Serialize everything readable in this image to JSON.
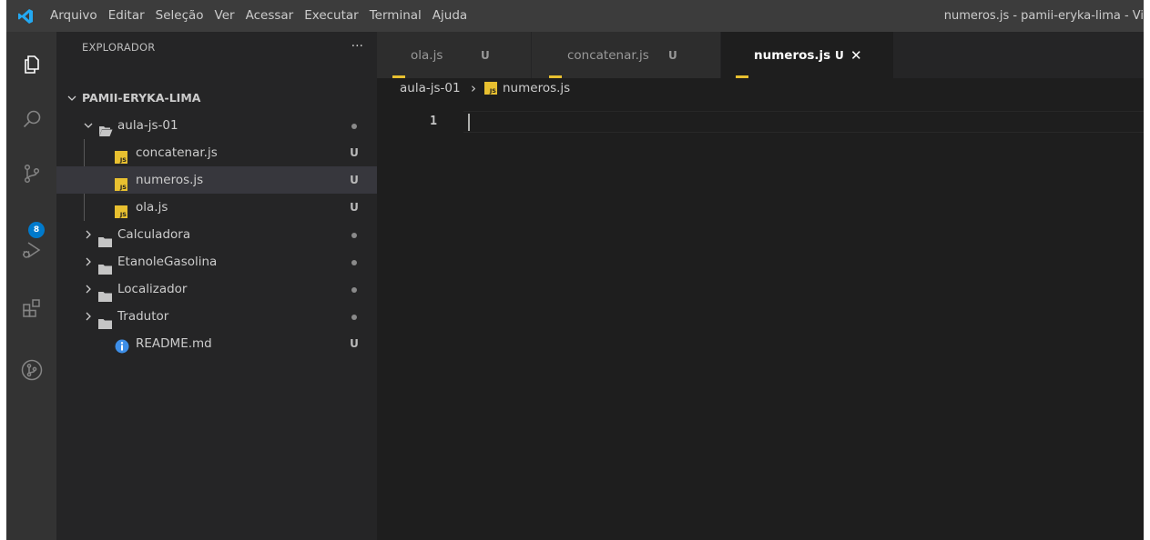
{
  "menu": {
    "items": [
      "Arquivo",
      "Editar",
      "Seleção",
      "Ver",
      "Acessar",
      "Executar",
      "Terminal",
      "Ajuda"
    ]
  },
  "window_title": "numeros.js - pamii-eryka-lima - Vi",
  "activity_bar": {
    "icons": [
      "explorer-icon",
      "search-icon",
      "source-control-icon",
      "run-debug-icon",
      "extensions-icon",
      "git-graph-icon"
    ],
    "scm_badge": "8"
  },
  "sidebar": {
    "title": "EXPLORADOR",
    "more_label": "···",
    "root_label": "PAMII-ERYKA-LIMA",
    "tree": [
      {
        "label": "aula-js-01",
        "type": "folder-open",
        "decoration": "dot"
      },
      {
        "label": "concatenar.js",
        "type": "js",
        "decoration": "U"
      },
      {
        "label": "numeros.js",
        "type": "js",
        "decoration": "U",
        "selected": true
      },
      {
        "label": "ola.js",
        "type": "js",
        "decoration": "U"
      },
      {
        "label": "Calculadora",
        "type": "folder",
        "decoration": "dot"
      },
      {
        "label": "EtanoleGasolina",
        "type": "folder",
        "decoration": "dot"
      },
      {
        "label": "Localizador",
        "type": "folder",
        "decoration": "dot"
      },
      {
        "label": "Tradutor",
        "type": "folder",
        "decoration": "dot"
      },
      {
        "label": "README.md",
        "type": "info",
        "decoration": "U"
      }
    ]
  },
  "tabs": [
    {
      "label": "ola.js",
      "status": "U",
      "active": false
    },
    {
      "label": "concatenar.js",
      "status": "U",
      "active": false
    },
    {
      "label": "numeros.js",
      "status": "U",
      "active": true,
      "close": "✕"
    }
  ],
  "breadcrumb": {
    "folder": "aula-js-01",
    "separator": "›",
    "file": "numeros.js"
  },
  "editor": {
    "line_number": "1"
  },
  "colors": {
    "accent": "#007acc",
    "js_icon": "#e8c030",
    "selection": "#37373d"
  }
}
